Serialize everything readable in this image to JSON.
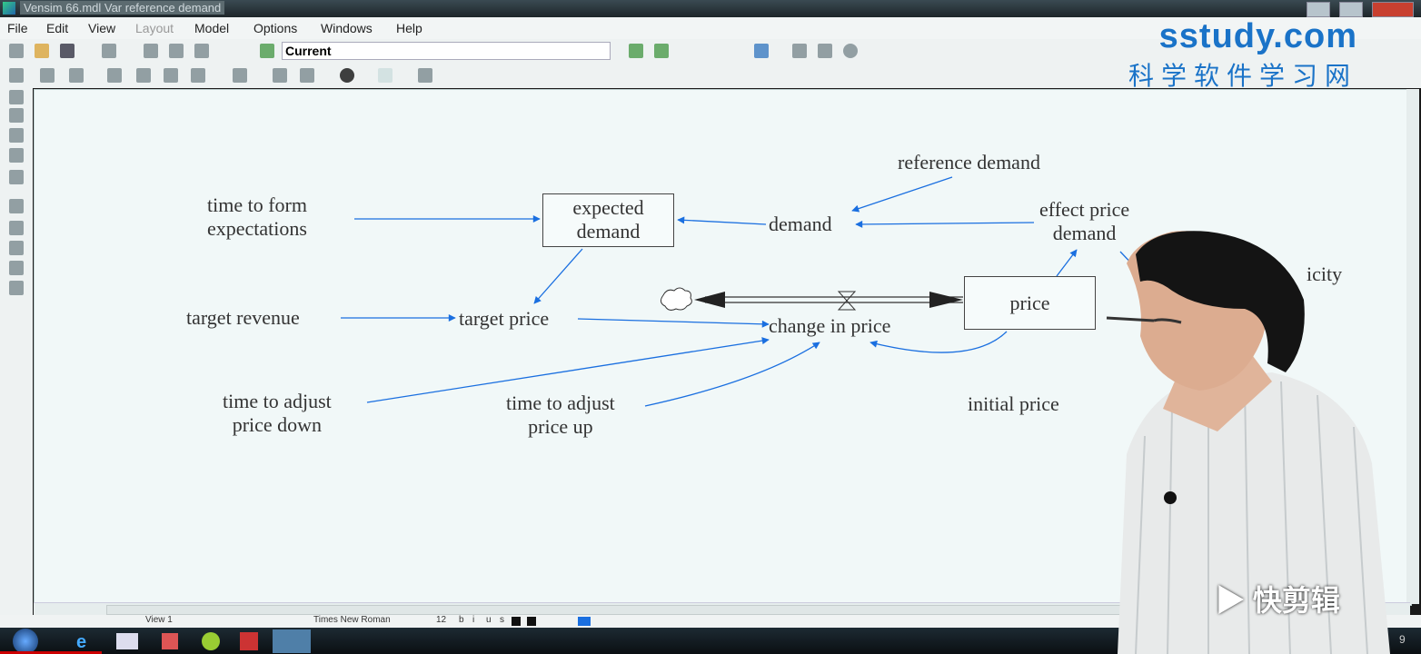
{
  "window": {
    "title": "Vensim 66.mdl Var reference demand"
  },
  "menu": [
    {
      "label": "File"
    },
    {
      "label": "Edit"
    },
    {
      "label": "View"
    },
    {
      "label": "Layout",
      "disabled": true
    },
    {
      "label": "Model"
    },
    {
      "label": "Options"
    },
    {
      "label": "Windows"
    },
    {
      "label": "Help"
    }
  ],
  "toolbar": {
    "run_name": "Current"
  },
  "diagram": {
    "variables": {
      "time_to_form": "time to form\nexpectations",
      "demand": "demand",
      "reference_demand": "reference demand",
      "effect_price_demand": "effect price\ndemand",
      "target_revenue": "target revenue",
      "target_price": "target price",
      "change_in_price": "change in price",
      "time_down": "time to adjust\nprice down",
      "time_up": "time to adjust\nprice up",
      "initial_price": "initial price",
      "elasticity_partial": "icity"
    },
    "levels": {
      "expected_demand": "expected\ndemand",
      "price": "price"
    },
    "arrow_color": "#1a6fe0"
  },
  "statusbar": {
    "view": "View 1",
    "font": "Times New Roman",
    "size": "12",
    "b": "b",
    "i": "i",
    "u": "u",
    "s": "s"
  },
  "watermark": {
    "brand": "sstudy.com",
    "brand_cn": "科学软件学习网",
    "editor": "快剪辑"
  },
  "taskbar": {
    "clock_partial": "9"
  }
}
